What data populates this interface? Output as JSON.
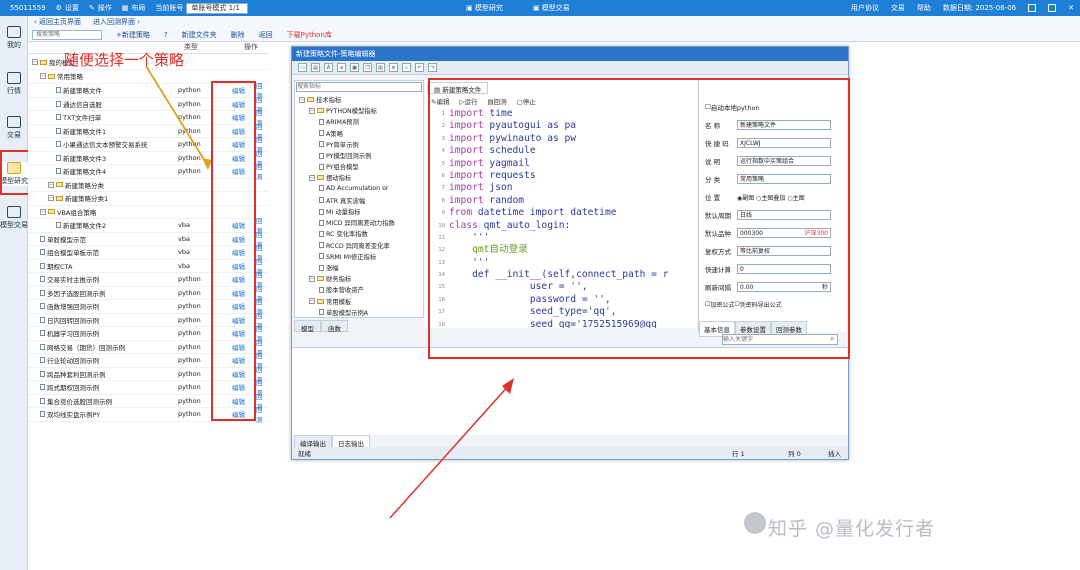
{
  "titlebar": {
    "account": "55011559",
    "settings": "设置",
    "ops": "操作",
    "layout": "布局",
    "current_account_label": "当前账号",
    "mode": "单账号模式  1/1",
    "tab_model_research": "模型研究",
    "tab_model_trade": "模型交易",
    "user_protocol": "用户协议",
    "trade": "交易",
    "help": "帮助",
    "date": "数据日期: 2025-06-06"
  },
  "sidebar": {
    "items": [
      "我的",
      "行情",
      "交易",
      "模型研究",
      "模型交易"
    ]
  },
  "toolbar1": {
    "back_main": "返回主页界面",
    "enter_backtest": "进入回测界面"
  },
  "toolbar2": {
    "search_placeholder": "搜索策略",
    "new_strategy": "+新建策略",
    "help_mark": "?",
    "new_folder": "新建文件夹",
    "delete": "删除",
    "back": "返回",
    "download": "下载Python库"
  },
  "tree": {
    "col_type": "类型",
    "col_op": "操作",
    "root": "我的模型",
    "folder1": "常用策略",
    "edit": "编辑",
    "backtest": "回测",
    "rows": [
      {
        "name": "新建策略文件",
        "type": "python",
        "indent": 3
      },
      {
        "name": "通达信自选股",
        "type": "python",
        "indent": 3
      },
      {
        "name": "TXT文件扫单",
        "type": "python",
        "indent": 3
      },
      {
        "name": "新建策略文件1",
        "type": "python",
        "indent": 3
      },
      {
        "name": "小果通达信文本预警交易系统",
        "type": "python",
        "indent": 3
      },
      {
        "name": "新建策略文件3",
        "type": "python",
        "indent": 3
      },
      {
        "name": "新建策略文件4",
        "type": "python",
        "indent": 3
      },
      {
        "name": "新建策略分类",
        "type": "",
        "indent": 2,
        "folder": true
      },
      {
        "name": "新建策略分类1",
        "type": "",
        "indent": 2,
        "folder": true
      },
      {
        "name": "VBA组合策略",
        "type": "",
        "indent": 1,
        "folder": true
      },
      {
        "name": "新建策略文件2",
        "type": "vba",
        "indent": 3
      },
      {
        "name": "单股模型示范",
        "type": "vba",
        "indent": 1
      },
      {
        "name": "组合模型单板示范",
        "type": "vba",
        "indent": 1
      },
      {
        "name": "期权CTA",
        "type": "vba",
        "indent": 1
      },
      {
        "name": "交易实时主推示例",
        "type": "python",
        "indent": 1
      },
      {
        "name": "多因子选股回测示例",
        "type": "python",
        "indent": 1
      },
      {
        "name": "函数增强回测示例",
        "type": "python",
        "indent": 1
      },
      {
        "name": "日内回转回测示例",
        "type": "python",
        "indent": 1
      },
      {
        "name": "机器学习回测示例",
        "type": "python",
        "indent": 1
      },
      {
        "name": "网格交易（期货）回测示例",
        "type": "python",
        "indent": 1
      },
      {
        "name": "行业轮动回测示例",
        "type": "python",
        "indent": 1
      },
      {
        "name": "跨品种套利回测示例",
        "type": "python",
        "indent": 1
      },
      {
        "name": "跨式期权回测示例",
        "type": "python",
        "indent": 1
      },
      {
        "name": "集合竞价选股回测示例",
        "type": "python",
        "indent": 1
      },
      {
        "name": "双均线实盘示例PY",
        "type": "python",
        "indent": 1
      }
    ]
  },
  "annotation": "随便选择一个策略",
  "editor": {
    "title": "新建策略文件-策略编辑器",
    "search_placeholder": "搜索指标",
    "file_tab": "新建策略文件",
    "sub_edit": "编辑",
    "sub_run": "运行",
    "sub_backtest": "回测",
    "sub_stop": "停止",
    "tree": [
      {
        "t": "技术指标",
        "lv": 0,
        "f": true
      },
      {
        "t": "PYTHON模型指标",
        "lv": 1,
        "f": true
      },
      {
        "t": "ARIMA预测",
        "lv": 2
      },
      {
        "t": "A策略",
        "lv": 2
      },
      {
        "t": "PY简单示例",
        "lv": 2
      },
      {
        "t": "PY模型回测示例",
        "lv": 2
      },
      {
        "t": "PY组合模型",
        "lv": 2
      },
      {
        "t": "摆动指标",
        "lv": 1,
        "f": true
      },
      {
        "t": "AD      Accumulation or",
        "lv": 2
      },
      {
        "t": "ATR     真实波幅",
        "lv": 2
      },
      {
        "t": "MI      动量指标",
        "lv": 2
      },
      {
        "t": "MICD    异同离差动力指数",
        "lv": 2
      },
      {
        "t": "RC      变化率指数",
        "lv": 2
      },
      {
        "t": "RCCD    异同离差变化率",
        "lv": 2
      },
      {
        "t": "SRMI    MI修正指标",
        "lv": 2
      },
      {
        "t": "涨幅",
        "lv": 2
      },
      {
        "t": "财务指标",
        "lv": 1,
        "f": true
      },
      {
        "t": "股本营收资产",
        "lv": 2
      },
      {
        "t": "常用模板",
        "lv": 1,
        "f": true
      },
      {
        "t": "单股模型示例A",
        "lv": 2
      },
      {
        "t": "单股模型示例B    引用模",
        "lv": 2
      }
    ],
    "left_tabs": [
      "模型",
      "函数"
    ],
    "line_numbers": [
      "1",
      "2",
      "3",
      "4",
      "5",
      "6",
      "7",
      "8",
      "9",
      "10",
      "11",
      "12",
      "13",
      "14",
      "15",
      "16",
      "17",
      "18"
    ],
    "code": [
      [
        "import",
        " time"
      ],
      [
        "import",
        " pyautogui as pa"
      ],
      [
        "import",
        " pywinauto as pw"
      ],
      [
        "import",
        " schedule"
      ],
      [
        "import",
        " yagmail"
      ],
      [
        "import",
        " requests"
      ],
      [
        "import",
        " json"
      ],
      [
        "import",
        " random"
      ],
      [
        "from",
        " datetime import datetime"
      ],
      [
        "class",
        " qmt_auto_login:"
      ],
      [
        "",
        "    '''"
      ],
      [
        "",
        "    qmt自动登录"
      ],
      [
        "",
        "    '''"
      ],
      [
        "",
        "    def __init__(self,connect_path = r"
      ],
      [
        "",
        "              user = '',"
      ],
      [
        "",
        "              password = '',"
      ],
      [
        "",
        "              seed_type='qq',"
      ],
      [
        "",
        "              seed_qq='1752515969@qq"
      ]
    ],
    "props": {
      "local_python": "启动本地python",
      "name_l": "名  称",
      "name_v": "新建策略文件",
      "short_l": "快 捷 码",
      "short_v": "XJCLWJ",
      "desc_l": "说  明",
      "desc_v": "运行指数中买策组合",
      "cat_l": "分  类",
      "cat_v": "常用策略",
      "pos_l": "位  置",
      "pos_opts": [
        "副图",
        "主图叠加",
        "主图"
      ],
      "period_l": "默认周期",
      "period_v": "日线",
      "stock_l": "默认品种",
      "stock_v": "000300",
      "stock_tag": "沪深300",
      "adjust_l": "复权方式",
      "adjust_v": "等比前复权",
      "fast_l": "快速计算",
      "fast_v": "0",
      "refresh_l": "刷新间隔",
      "refresh_v": "0.00",
      "refresh_unit": "秒",
      "encrypt": "加密公式",
      "import_fn": "凭密码导出公式",
      "search_placeholder": "输入关键字"
    },
    "props_tabs": [
      "基本信息",
      "参数设置",
      "回测参数"
    ],
    "out_tabs": [
      "编译输出",
      "日志输出"
    ],
    "status": {
      "ready": "就绪",
      "row": "行 1",
      "col": "列 0",
      "mode": "插入"
    }
  },
  "watermark": "知乎 @量化发行者"
}
